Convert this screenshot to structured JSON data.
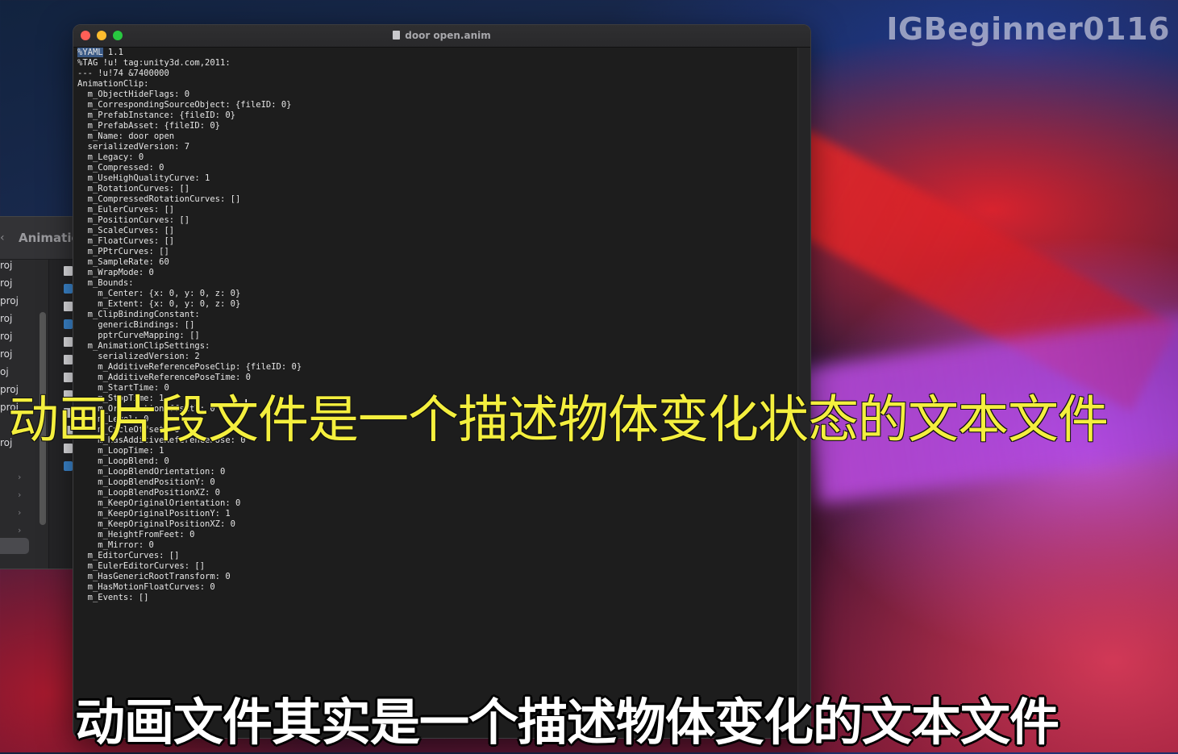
{
  "watermark": "IGBeginner0116",
  "finder": {
    "title": "Animation",
    "back_icon": "chevron-left-icon",
    "sidebar_items": [
      "roj",
      "roj",
      "proj",
      "roj",
      "roj",
      "roj",
      "oj",
      "proj",
      "proj",
      "roj"
    ],
    "column_icons": [
      "file",
      "folder",
      "file",
      "folder",
      "file",
      "file",
      "file",
      "file",
      "file",
      "file",
      "file",
      "folder"
    ]
  },
  "editor": {
    "title": "door open.anim",
    "title_icon": "document-icon",
    "first_line_highlight": "%YAML",
    "first_line_rest": " 1.1",
    "lines": [
      "%TAG !u! tag:unity3d.com,2011:",
      "--- !u!74 &7400000",
      "AnimationClip:",
      "  m_ObjectHideFlags: 0",
      "  m_CorrespondingSourceObject: {fileID: 0}",
      "  m_PrefabInstance: {fileID: 0}",
      "  m_PrefabAsset: {fileID: 0}",
      "  m_Name: door open",
      "  serializedVersion: 7",
      "  m_Legacy: 0",
      "  m_Compressed: 0",
      "  m_UseHighQualityCurve: 1",
      "  m_RotationCurves: []",
      "  m_CompressedRotationCurves: []",
      "  m_EulerCurves: []",
      "  m_PositionCurves: []",
      "  m_ScaleCurves: []",
      "  m_FloatCurves: []",
      "  m_PPtrCurves: []",
      "  m_SampleRate: 60",
      "  m_WrapMode: 0",
      "  m_Bounds:",
      "    m_Center: {x: 0, y: 0, z: 0}",
      "    m_Extent: {x: 0, y: 0, z: 0}",
      "  m_ClipBindingConstant:",
      "    genericBindings: []",
      "    pptrCurveMapping: []",
      "  m_AnimationClipSettings:",
      "    serializedVersion: 2",
      "    m_AdditiveReferencePoseClip: {fileID: 0}",
      "    m_AdditiveReferencePoseTime: 0",
      "    m_StartTime: 0",
      "    m_StopTime: 1",
      "    m_OrientationOffsetY: 0",
      "    m_Level: 0",
      "    m_CycleOffset: 0",
      "    m_HasAdditiveReferencePose: 0",
      "    m_LoopTime: 1",
      "    m_LoopBlend: 0",
      "    m_LoopBlendOrientation: 0",
      "    m_LoopBlendPositionY: 0",
      "    m_LoopBlendPositionXZ: 0",
      "    m_KeepOriginalOrientation: 0",
      "    m_KeepOriginalPositionY: 1",
      "    m_KeepOriginalPositionXZ: 0",
      "    m_HeightFromFeet: 0",
      "    m_Mirror: 0",
      "  m_EditorCurves: []",
      "  m_EulerEditorCurves: []",
      "  m_HasGenericRootTransform: 0",
      "  m_HasMotionFloatCurves: 0",
      "  m_Events: []"
    ]
  },
  "subtitles": {
    "top": "动画片段文件是一个描述物体变化状态的文本文件",
    "bottom": "动画文件其实是一个描述物体变化的文本文件"
  },
  "colors": {
    "subtitle_top": "#f4ef3e",
    "subtitle_bottom": "#ffffff",
    "traffic_close": "#ff5f57",
    "traffic_min": "#febc2e",
    "traffic_max": "#28c840"
  }
}
